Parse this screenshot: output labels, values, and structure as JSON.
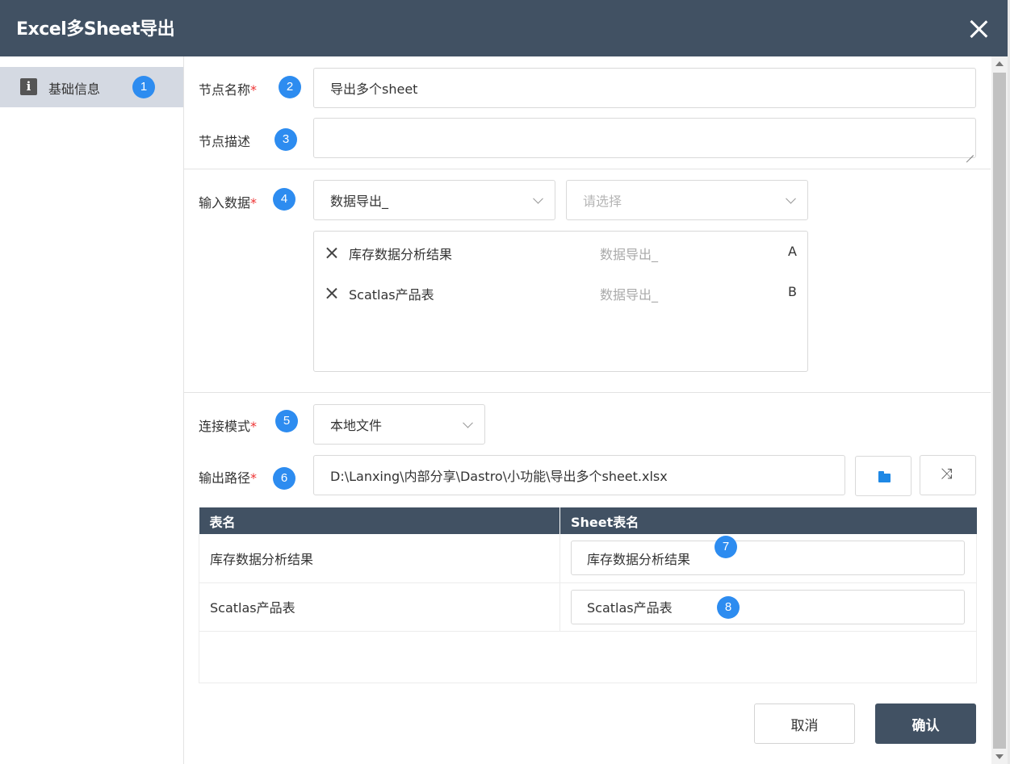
{
  "dialog": {
    "title": "Excel多Sheet导出"
  },
  "sidebar": {
    "items": [
      {
        "label": "基础信息",
        "badge": "1"
      }
    ]
  },
  "fields": {
    "node_name": {
      "label": "节点名称",
      "required_mark": "*",
      "value": "导出多个sheet",
      "badge": "2"
    },
    "node_desc": {
      "label": "节点描述",
      "value": "",
      "badge": "3"
    },
    "input_data": {
      "label": "输入数据",
      "required_mark": "*",
      "badge": "4",
      "select1_value": "数据导出_",
      "select2_placeholder": "请选择",
      "items": [
        {
          "name": "库存数据分析结果",
          "source": "数据导出_",
          "key": "A"
        },
        {
          "name": "Scatlas产品表",
          "source": "数据导出_",
          "key": "B"
        }
      ]
    },
    "connect_mode": {
      "label": "连接模式",
      "required_mark": "*",
      "value": "本地文件",
      "badge": "5"
    },
    "output_path": {
      "label": "输出路径",
      "required_mark": "*",
      "value": "D:\\Lanxing\\内部分享\\Dastro\\小功能\\导出多个sheet.xlsx",
      "badge": "6"
    }
  },
  "table": {
    "headers": [
      "表名",
      "Sheet表名"
    ],
    "rows": [
      {
        "table_name": "库存数据分析结果",
        "sheet_name": "库存数据分析结果",
        "badge": "7"
      },
      {
        "table_name": "Scatlas产品表",
        "sheet_name": "Scatlas产品表",
        "badge": "8"
      }
    ]
  },
  "footer": {
    "cancel_label": "取消",
    "confirm_label": "确认"
  },
  "icons": {
    "close": "close-icon",
    "info": "info-icon",
    "remove": "close-icon",
    "folder": "folder-open-icon",
    "shuffle": "shuffle-icon",
    "chevron": "chevron-down-icon"
  },
  "colors": {
    "header_bg": "#415163",
    "badge": "#2d8cf0",
    "required": "#e33333",
    "sidebar_active": "#d4d9e2",
    "folder_icon": "#1e88e5"
  }
}
